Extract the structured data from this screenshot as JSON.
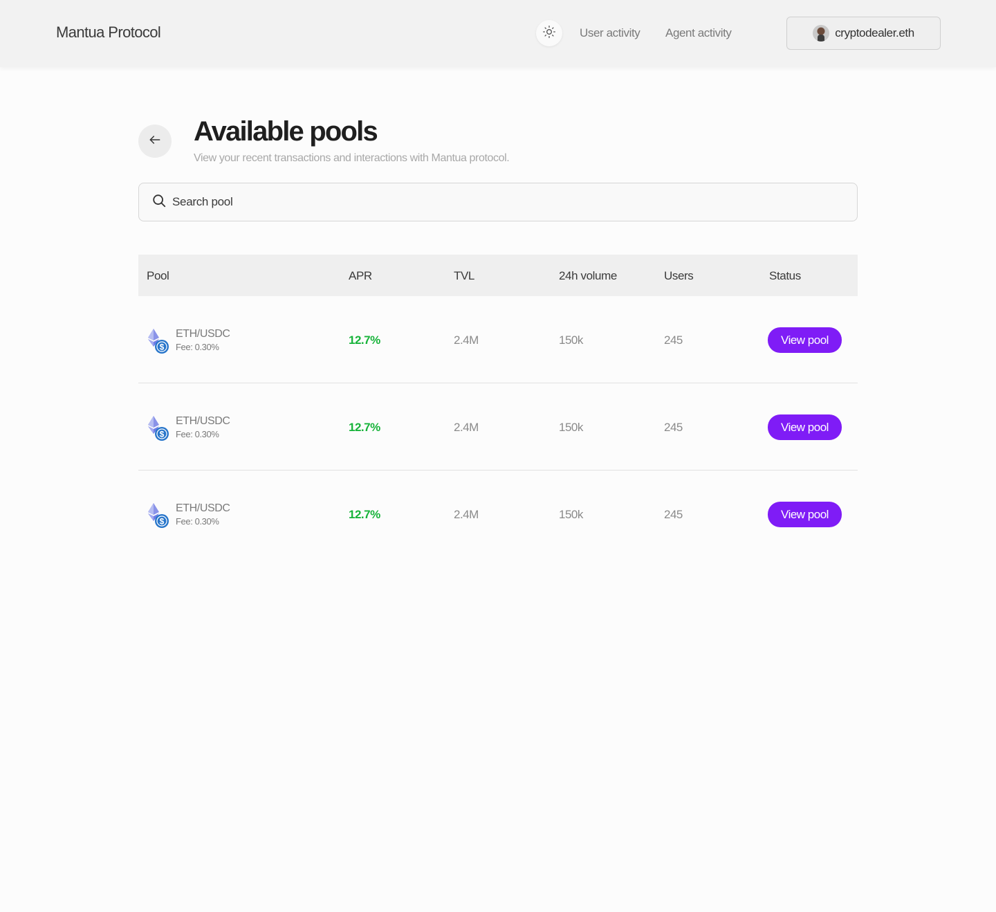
{
  "header": {
    "brand": "Mantua Protocol",
    "theme_icon": "sun-icon",
    "nav": [
      {
        "label": "User activity"
      },
      {
        "label": "Agent activity"
      }
    ],
    "wallet": {
      "name": "cryptodealer.eth"
    }
  },
  "page": {
    "back_icon": "arrow-left-icon",
    "title": "Available pools",
    "subtitle": "View your recent transactions and interactions with Mantua protocol."
  },
  "search": {
    "placeholder": "Search pool",
    "value": ""
  },
  "table": {
    "columns": [
      "Pool",
      "APR",
      "TVL",
      "24h volume",
      "Users",
      "Status"
    ],
    "rows": [
      {
        "pool": "ETH/USDC",
        "fee": "Fee: 0.30%",
        "apr": "12.7%",
        "tvl": "2.4M",
        "volume": "150k",
        "users": "245",
        "action": "View pool"
      },
      {
        "pool": "ETH/USDC",
        "fee": "Fee: 0.30%",
        "apr": "12.7%",
        "tvl": "2.4M",
        "volume": "150k",
        "users": "245",
        "action": "View pool"
      },
      {
        "pool": "ETH/USDC",
        "fee": "Fee: 0.30%",
        "apr": "12.7%",
        "tvl": "2.4M",
        "volume": "150k",
        "users": "245",
        "action": "View pool"
      }
    ]
  },
  "colors": {
    "accent": "#7f1cf6",
    "positive": "#17b33a",
    "eth": "#6f7de6",
    "usdc": "#2775ca"
  }
}
